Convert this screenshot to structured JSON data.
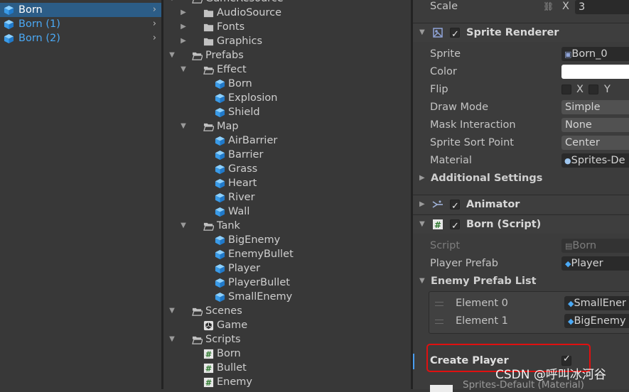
{
  "hierarchy": {
    "items": [
      {
        "label": "Born",
        "selected": true,
        "icon": "prefab-cube-icon"
      },
      {
        "label": "Born (1)",
        "selected": false,
        "icon": "prefab-cube-icon"
      },
      {
        "label": "Born (2)",
        "selected": false,
        "icon": "prefab-cube-icon"
      }
    ]
  },
  "project": {
    "items": [
      {
        "label": "GameResource",
        "type": "folder",
        "depth": 0,
        "expanded": true
      },
      {
        "label": "AudioSource",
        "type": "folder",
        "depth": 1,
        "expanded": false
      },
      {
        "label": "Fonts",
        "type": "folder",
        "depth": 1,
        "expanded": false
      },
      {
        "label": "Graphics",
        "type": "folder",
        "depth": 1,
        "expanded": false
      },
      {
        "label": "Prefabs",
        "type": "folder",
        "depth": 0,
        "expanded": true
      },
      {
        "label": "Effect",
        "type": "folder",
        "depth": 1,
        "expanded": true
      },
      {
        "label": "Born",
        "type": "prefab",
        "depth": 2
      },
      {
        "label": "Explosion",
        "type": "prefab",
        "depth": 2
      },
      {
        "label": "Shield",
        "type": "prefab",
        "depth": 2
      },
      {
        "label": "Map",
        "type": "folder",
        "depth": 1,
        "expanded": true
      },
      {
        "label": "AirBarrier",
        "type": "prefab",
        "depth": 2
      },
      {
        "label": "Barrier",
        "type": "prefab",
        "depth": 2
      },
      {
        "label": "Grass",
        "type": "prefab",
        "depth": 2
      },
      {
        "label": "Heart",
        "type": "prefab",
        "depth": 2
      },
      {
        "label": "River",
        "type": "prefab",
        "depth": 2
      },
      {
        "label": "Wall",
        "type": "prefab",
        "depth": 2
      },
      {
        "label": "Tank",
        "type": "folder",
        "depth": 1,
        "expanded": true
      },
      {
        "label": "BigEnemy",
        "type": "prefab",
        "depth": 2
      },
      {
        "label": "EnemyBullet",
        "type": "prefab",
        "depth": 2
      },
      {
        "label": "Player",
        "type": "prefab",
        "depth": 2
      },
      {
        "label": "PlayerBullet",
        "type": "prefab",
        "depth": 2
      },
      {
        "label": "SmallEnemy",
        "type": "prefab",
        "depth": 2
      },
      {
        "label": "Scenes",
        "type": "folder",
        "depth": 0,
        "expanded": true
      },
      {
        "label": "Game",
        "type": "scene",
        "depth": 1
      },
      {
        "label": "Scripts",
        "type": "folder",
        "depth": 0,
        "expanded": true
      },
      {
        "label": "Born",
        "type": "script",
        "depth": 1
      },
      {
        "label": "Bullet",
        "type": "script",
        "depth": 1
      },
      {
        "label": "Enemy",
        "type": "script",
        "depth": 1
      }
    ]
  },
  "inspector": {
    "scale": {
      "label": "Scale",
      "axis": "X",
      "value": "3"
    },
    "sprite_renderer": {
      "title": "Sprite Renderer",
      "enabled": true,
      "sprite": {
        "label": "Sprite",
        "value": "Born_0"
      },
      "color": {
        "label": "Color",
        "value": "#ffffff"
      },
      "flip": {
        "label": "Flip",
        "x": "X",
        "y": "Y"
      },
      "draw_mode": {
        "label": "Draw Mode",
        "value": "Simple"
      },
      "mask_interaction": {
        "label": "Mask Interaction",
        "value": "None"
      },
      "sprite_sort_point": {
        "label": "Sprite Sort Point",
        "value": "Center"
      },
      "material": {
        "label": "Material",
        "value": "Sprites-De"
      },
      "additional": "Additional Settings"
    },
    "animator": {
      "title": "Animator",
      "enabled": true
    },
    "born_script": {
      "title": "Born (Script)",
      "enabled": true,
      "script": {
        "label": "Script",
        "value": "Born"
      },
      "player_prefab": {
        "label": "Player Prefab",
        "value": "Player"
      },
      "enemy_list": {
        "title": "Enemy Prefab List",
        "elements": [
          {
            "label": "Element 0",
            "value": "SmallEner"
          },
          {
            "label": "Element 1",
            "value": "BigEnemy"
          }
        ]
      },
      "create_player": {
        "label": "Create Player",
        "checked": true
      }
    },
    "material_preview": "Sprites-Default (Material)"
  },
  "watermark": "CSDN @呼叫冰河谷",
  "colors": {
    "selection": "#2c5d87",
    "prefab_blue": "#4ba9f5",
    "highlight_red": "#e01010"
  }
}
